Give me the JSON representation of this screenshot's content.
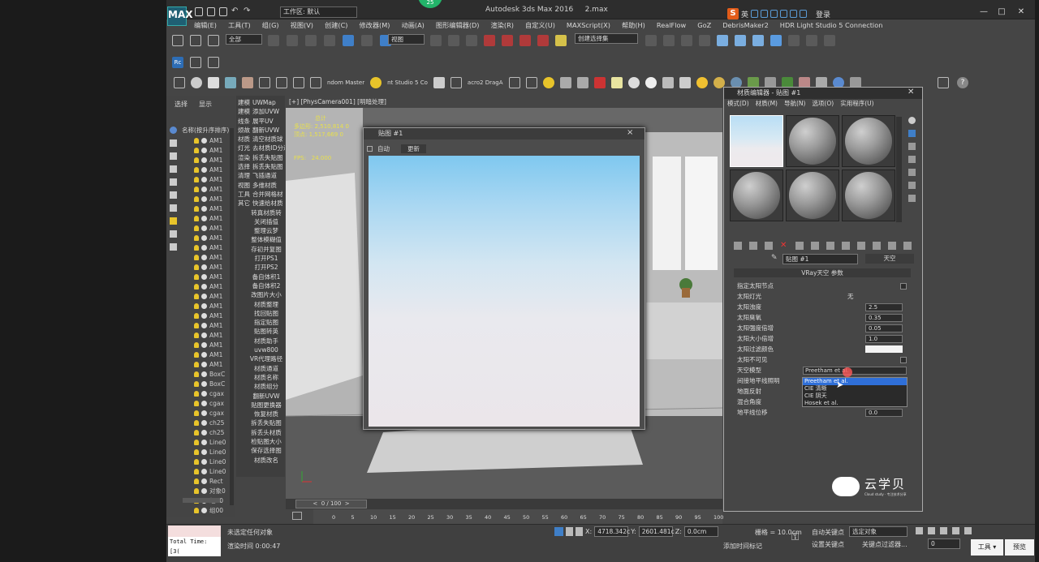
{
  "app": {
    "title": "Autodesk 3ds Max 2016",
    "file": "2.max",
    "workspace_label": "工作区: 默认",
    "badge": "25",
    "logo": "MAX"
  },
  "ime": {
    "lang": "英",
    "login": "登录"
  },
  "menus": [
    "编辑(E)",
    "工具(T)",
    "组(G)",
    "视图(V)",
    "创建(C)",
    "修改器(M)",
    "动画(A)",
    "图形编辑器(D)",
    "渲染(R)",
    "自定义(U)",
    "MAXScript(X)",
    "帮助(H)",
    "RealFlow",
    "GoZ",
    "DebrisMaker2",
    "HDR Light Studio 5 Connection"
  ],
  "toolbar": {
    "filter_all": "全部",
    "view_select": "视图",
    "selection_set": "创建选择集",
    "plugins": [
      "ndom Master",
      "nt Studio 5 Co",
      "acro2 DragA"
    ]
  },
  "left_tabs": [
    "选择",
    "显示"
  ],
  "scene_header": "名称(按升序排序)",
  "scene_items": [
    "AM1",
    "AM1",
    "AM1",
    "AM1",
    "AM1",
    "AM1",
    "AM1",
    "AM1",
    "AM1",
    "AM1",
    "AM1",
    "AM1",
    "AM1",
    "AM1",
    "AM1",
    "AM1",
    "AM1",
    "AM1",
    "AM1",
    "AM1",
    "AM1",
    "AM1",
    "AM1",
    "AM1",
    "BoxC",
    "BoxC",
    "cgax",
    "cgax",
    "cgax",
    "ch25",
    "ch25",
    "Line0",
    "Line0",
    "Line0",
    "Line0",
    "Rect",
    "对象0",
    "组00",
    "组00"
  ],
  "mid_top": [
    [
      "建模",
      "UWMap"
    ],
    [
      "建模",
      "添加UVW"
    ],
    [
      "线条",
      "展平UV"
    ],
    [
      "烦故",
      "翻新UVW"
    ],
    [
      "材质",
      "清空材质球"
    ],
    [
      "灯光",
      "去材质ID分进"
    ],
    [
      "渲染",
      "拆丢失贴图"
    ],
    [
      "选择",
      "拆丢失贴图"
    ],
    [
      "清理",
      "飞插通道"
    ],
    [
      "视图",
      "多维材质"
    ],
    [
      "工具",
      "合并网格材"
    ],
    [
      "其它",
      "快速给材质"
    ]
  ],
  "mid_items": [
    "转真材质转",
    "关闭插值",
    "整理云梦",
    "整体模糊值",
    "存初并复图",
    "打开PS1",
    "打开PS2",
    "备自体积1",
    "备自体积2",
    "改图片大小",
    "材质整理",
    "找回贴图",
    "指定贴图",
    "贴图转英",
    "材质助手",
    "uvw800",
    "VR代理路径",
    "材质通道",
    "材质名称",
    "材质组分",
    "翻新UVW",
    "贴图更换器",
    "恢复材质",
    "拆丢失贴图",
    "拆丢头材质",
    "检贴图大小",
    "保存选择图",
    "材质改名"
  ],
  "viewport": {
    "label": "[+] [PhysCamera001] [明暗处理]",
    "stats_header": "总计",
    "stats_polys_label": "多边形:",
    "stats_polys": "2,510,814",
    "stats_polys_sel": "0",
    "stats_verts_label": "顶点:",
    "stats_verts": "1,517,669",
    "stats_verts_sel": "0",
    "fps_label": "FPS:",
    "fps": "24.000"
  },
  "preview": {
    "title": "贴图 #1",
    "auto_label": "自动",
    "update_label": "更新",
    "close": "×"
  },
  "mated": {
    "title": "材质编辑器 - 贴图 #1",
    "menu": [
      "模式(D)",
      "材质(M)",
      "导航(N)",
      "选项(O)",
      "实用程序(U)"
    ],
    "map_name": "贴图 #1",
    "map_type": "天空",
    "rollout": "VRay天空 参数",
    "params": [
      {
        "label": "指定太阳节点",
        "value": "",
        "type": "check"
      },
      {
        "label": "太阳灯光",
        "value": "无",
        "type": "text"
      },
      {
        "label": "太阳浊度",
        "value": "2.5",
        "type": "spin"
      },
      {
        "label": "太阳臭氧",
        "value": "0.35",
        "type": "spin"
      },
      {
        "label": "太阳强度倍增",
        "value": "0.05",
        "type": "spin"
      },
      {
        "label": "太阳大小倍增",
        "value": "1.0",
        "type": "spin"
      },
      {
        "label": "太阳过滤颜色",
        "value": "",
        "type": "color"
      },
      {
        "label": "太阳不可见",
        "value": "",
        "type": "check"
      },
      {
        "label": "天空模型",
        "value": "Preetham et al.",
        "type": "dropdown"
      },
      {
        "label": "间接地平线照明",
        "value": "",
        "type": "blank"
      },
      {
        "label": "地面反射",
        "value": "",
        "type": "blank"
      },
      {
        "label": "混合角度",
        "value": "",
        "type": "blank"
      },
      {
        "label": "地平线位移",
        "value": "0.0",
        "type": "spin"
      }
    ],
    "sky_models": [
      "Preetham et al.",
      "CIE 清晰",
      "CIE 阴天",
      "Hosek et al."
    ],
    "sky_model_selected_index": 0
  },
  "watermark": {
    "brand": "云学贝",
    "sub": "Cloud study · 专注技术分享"
  },
  "timeline": {
    "frame": "0 / 100",
    "ticks": [
      "0",
      "5",
      "10",
      "15",
      "20",
      "25",
      "30",
      "35",
      "40",
      "45",
      "50",
      "55",
      "60",
      "65",
      "70",
      "75",
      "80",
      "85",
      "90",
      "95",
      "100"
    ]
  },
  "status": {
    "maxscript": "Total Time: [3(",
    "no_selection": "未选定任何对象",
    "render_time": "渲染时间 0:00:47",
    "x_label": "X:",
    "x": "4718.342c",
    "y_label": "Y:",
    "y": "2601.481c",
    "z_label": "Z:",
    "z": "0.0cm",
    "grid": "栅格 = 10.0cm",
    "add_tag": "添加时间标记",
    "auto_key": "自动关键点",
    "set_key": "设置关键点",
    "selected": "选定对象",
    "key_filter": "关键点过滤器...",
    "tools": "工具",
    "preview": "预览",
    "frame_field": "0"
  },
  "colors": {
    "accent": "#2f6fd8",
    "stats": "#e8e04c",
    "brand_bg": "#e25c1a"
  }
}
